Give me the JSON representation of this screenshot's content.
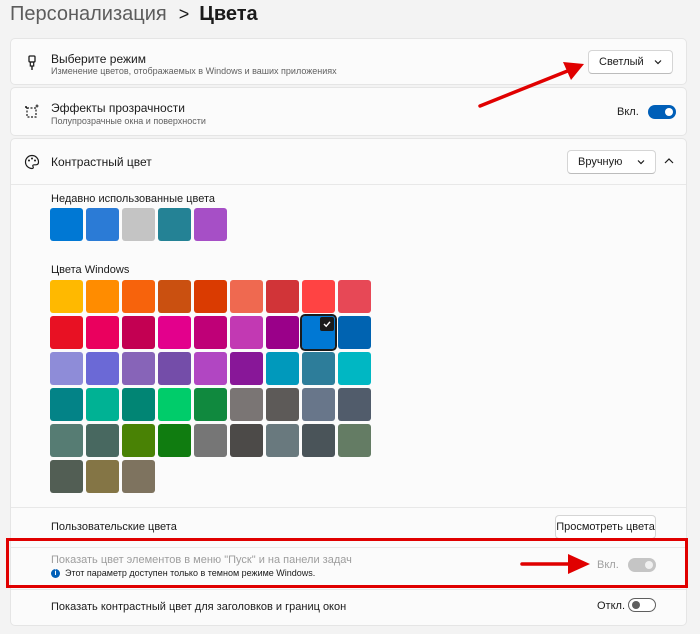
{
  "breadcrumb": {
    "parent": "Персонализация",
    "separator": ">",
    "current": "Цвета"
  },
  "mode": {
    "title": "Выберите режим",
    "subtitle": "Изменение цветов, отображаемых в Windows и ваших приложениях",
    "value": "Светлый",
    "icon": "brush-icon"
  },
  "transparency": {
    "title": "Эффекты прозрачности",
    "subtitle": "Полупрозрачные окна и поверхности",
    "toggle_label": "Вкл.",
    "state": "on",
    "icon": "transparency-icon"
  },
  "accent": {
    "title": "Контрастный цвет",
    "value": "Вручную",
    "icon": "palette-icon",
    "recent_label": "Недавно использованные цвета",
    "recent_colors": [
      "#0078d4",
      "#2b7bd6",
      "#c4c4c4",
      "#248295",
      "#a64fc6"
    ],
    "windows_label": "Цвета Windows",
    "windows_colors": [
      [
        "#ffb900",
        "#ff8c00",
        "#f7630c",
        "#ca5010",
        "#da3b01",
        "#ef6950",
        "#d13438",
        "#ff4343",
        "#e74856"
      ],
      [
        "#e81123",
        "#ea005e",
        "#c30052",
        "#e3008c",
        "#bf0077",
        "#c239b3",
        "#9a0089",
        "#0078d4",
        "#0063b1"
      ],
      [
        "#8e8cd8",
        "#6b69d6",
        "#8764b8",
        "#744da9",
        "#b146c2",
        "#881798",
        "#0099bc",
        "#2d7d9a",
        "#00b7c3"
      ],
      [
        "#038387",
        "#00b294",
        "#018574",
        "#00cc6a",
        "#10893e",
        "#7a7574",
        "#5d5a58",
        "#68768a",
        "#515c6b"
      ],
      [
        "#567c73",
        "#486860",
        "#498205",
        "#107c10",
        "#767676",
        "#4c4a48",
        "#69797e",
        "#4a5459",
        "#647c64"
      ],
      [
        "#525e54",
        "#847545",
        "#7e735f"
      ]
    ],
    "selected_color": "#0078d4",
    "custom_label": "Пользовательские цвета",
    "view_colors_button": "Просмотреть цвета"
  },
  "start_taskbar": {
    "title": "Показать цвет элементов в меню \"Пуск\" и на панели задач",
    "info": "Этот параметр доступен только в темном режиме Windows.",
    "toggle_label": "Вкл.",
    "state": "disabled-on"
  },
  "title_bars": {
    "title": "Показать контрастный цвет для заголовков и границ окон",
    "toggle_label": "Откл.",
    "state": "off"
  },
  "annotations": {
    "color": "#e00000"
  }
}
